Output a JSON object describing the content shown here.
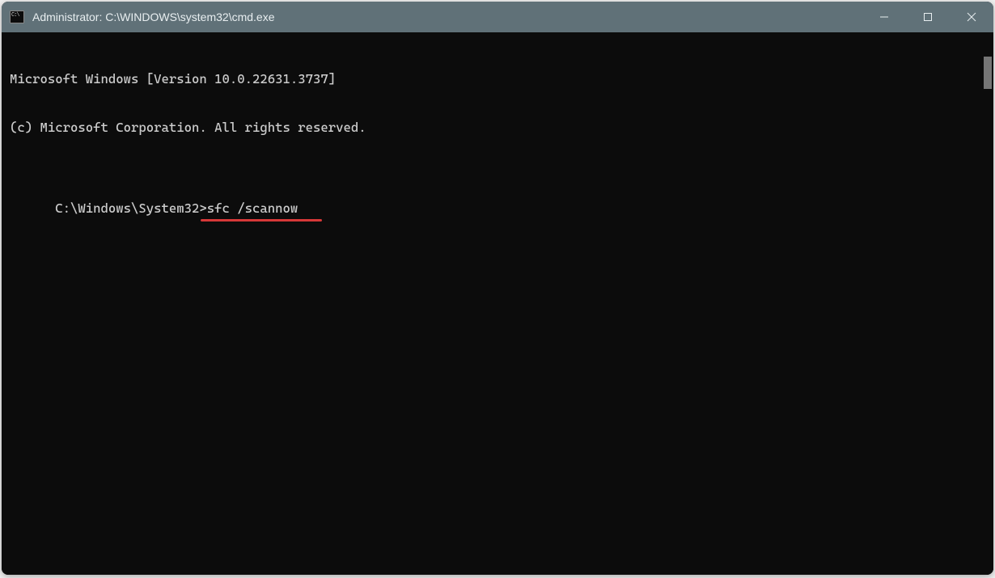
{
  "window": {
    "title": "Administrator: C:\\WINDOWS\\system32\\cmd.exe"
  },
  "terminal": {
    "line1": "Microsoft Windows [Version 10.0.22631.3737]",
    "line2": "(c) Microsoft Corporation. All rights reserved.",
    "prompt": "C:\\Windows\\System32>",
    "command": "sfc /scannow"
  },
  "annotation": {
    "underline_color": "#d63838"
  }
}
